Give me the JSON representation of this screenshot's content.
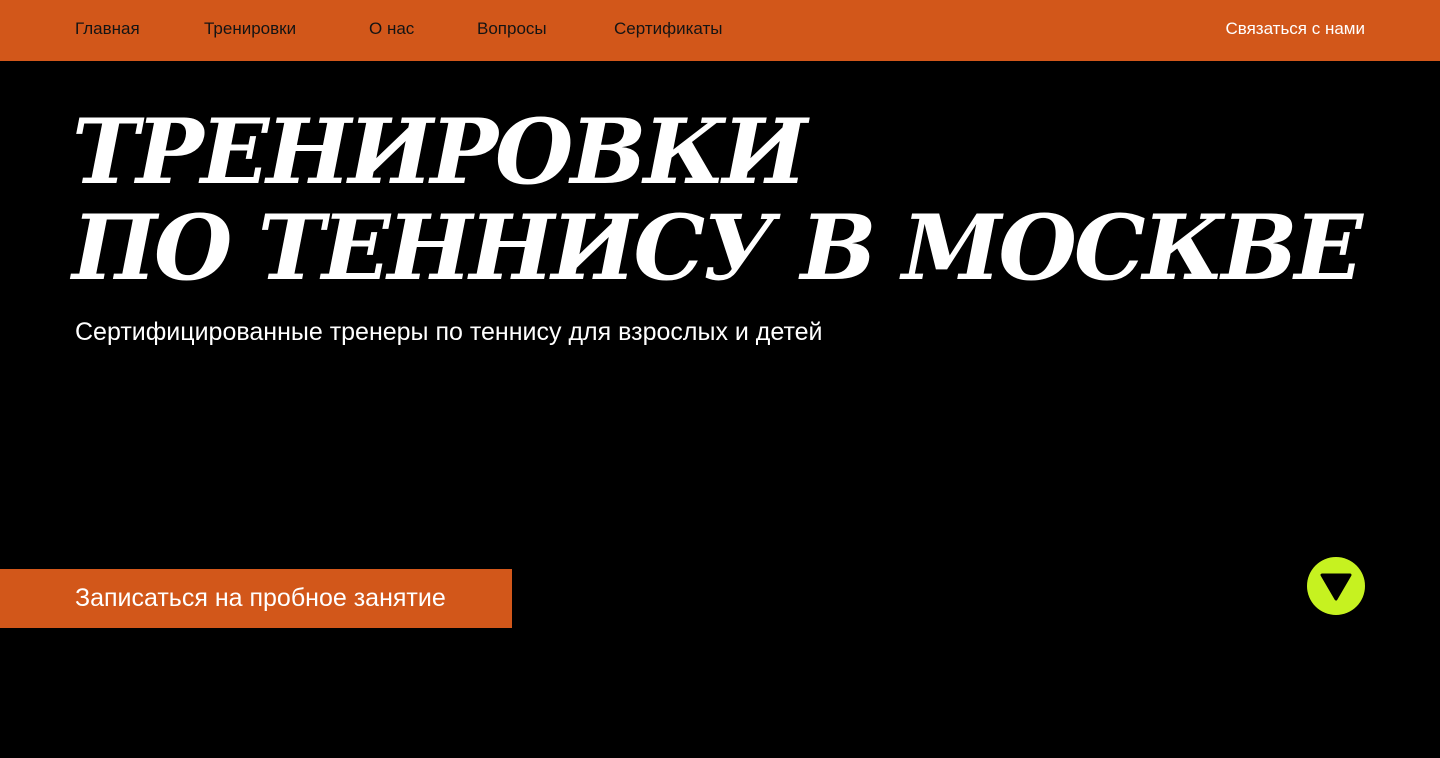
{
  "nav": {
    "items": [
      {
        "label": "Главная"
      },
      {
        "label": "Тренировки"
      },
      {
        "label": "О нас"
      },
      {
        "label": "Вопросы"
      },
      {
        "label": "Сертификаты"
      }
    ],
    "contact_label": "Связаться  с нами"
  },
  "hero": {
    "title_line1": "ТРЕНИРОВКИ",
    "title_line2": "ПО ТЕННИСУ В МОСКВЕ",
    "subtitle": "Сертифицированные тренеры по теннису для взрослых и детей",
    "cta_label": "Записаться на пробное занятие",
    "scroll_icon": "arrow-down-triangle-icon"
  },
  "colors": {
    "accent_orange": "#d2571a",
    "accent_lime": "#c6f220",
    "background": "#000000",
    "text_light": "#ffffff",
    "nav_text": "#141414"
  }
}
